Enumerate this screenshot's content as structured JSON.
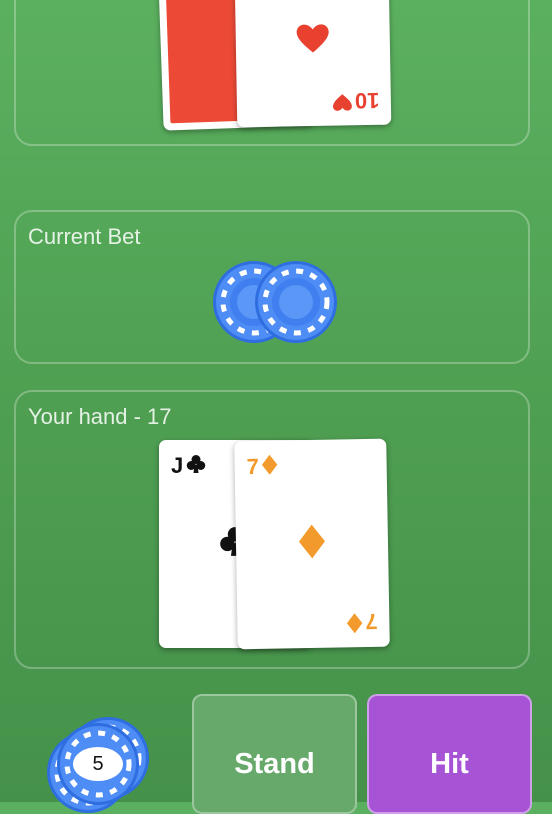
{
  "dealer": {
    "visible_card": {
      "rank": "10",
      "suit": "hearts",
      "suit_icon": "heart-icon",
      "color": "#e8412f"
    },
    "hidden_card": {
      "back_color": "#ec4a36"
    }
  },
  "bet": {
    "label": "Current Bet",
    "chip_count": 2,
    "chip_color": "#3d7ff0"
  },
  "player": {
    "label": "Your hand - 17",
    "cards": [
      {
        "rank": "J",
        "suit": "clubs",
        "suit_icon": "club-icon",
        "color": "#111111"
      },
      {
        "rank": "7",
        "suit": "diamonds",
        "suit_icon": "diamond-icon",
        "color": "#f29a2b"
      }
    ]
  },
  "controls": {
    "chip_value": "5",
    "stand_label": "Stand",
    "hit_label": "Hit",
    "stand_color": "#67a96b",
    "hit_color": "#a653d6"
  }
}
